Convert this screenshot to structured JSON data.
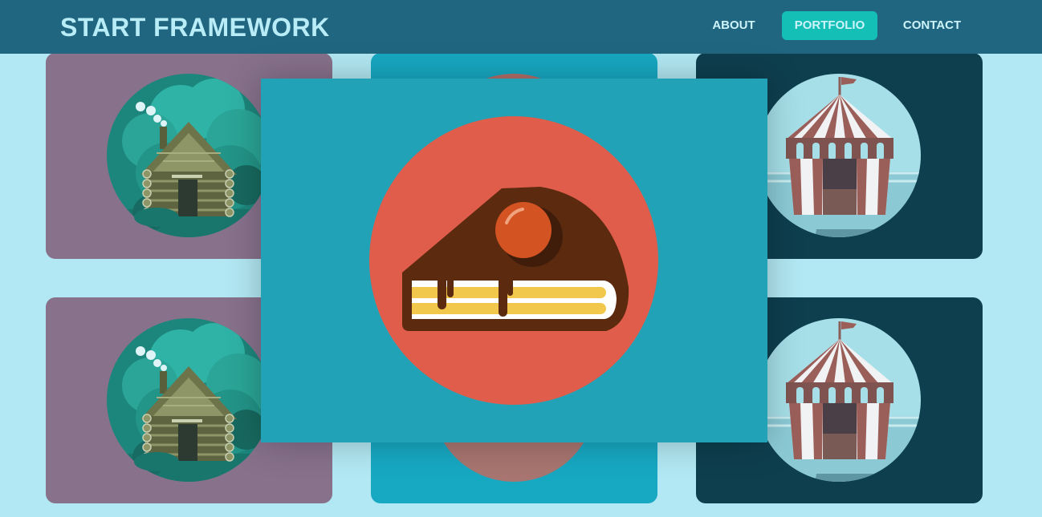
{
  "navbar": {
    "brand": "START FRAMEWORK",
    "links": [
      {
        "label": "ABOUT",
        "active": false
      },
      {
        "label": "PORTFOLIO",
        "active": true
      },
      {
        "label": "CONTACT",
        "active": false
      }
    ]
  },
  "portfolio": {
    "items": [
      {
        "icon": "cabin-icon",
        "background": "#87718b"
      },
      {
        "icon": "cake-icon",
        "background": "#17a8c2"
      },
      {
        "icon": "circus-tent-icon",
        "background": "#0e3f4f"
      },
      {
        "icon": "cabin-icon",
        "background": "#87718b"
      },
      {
        "icon": "cake-icon",
        "background": "#17a8c2"
      },
      {
        "icon": "circus-tent-icon",
        "background": "#0e3f4f"
      }
    ]
  },
  "modal": {
    "icon": "cake-icon",
    "background": "#21a2b6"
  },
  "colors": {
    "navbar": "#216680",
    "page_background": "#b2e8f3",
    "active_link": "#14bfb5"
  }
}
